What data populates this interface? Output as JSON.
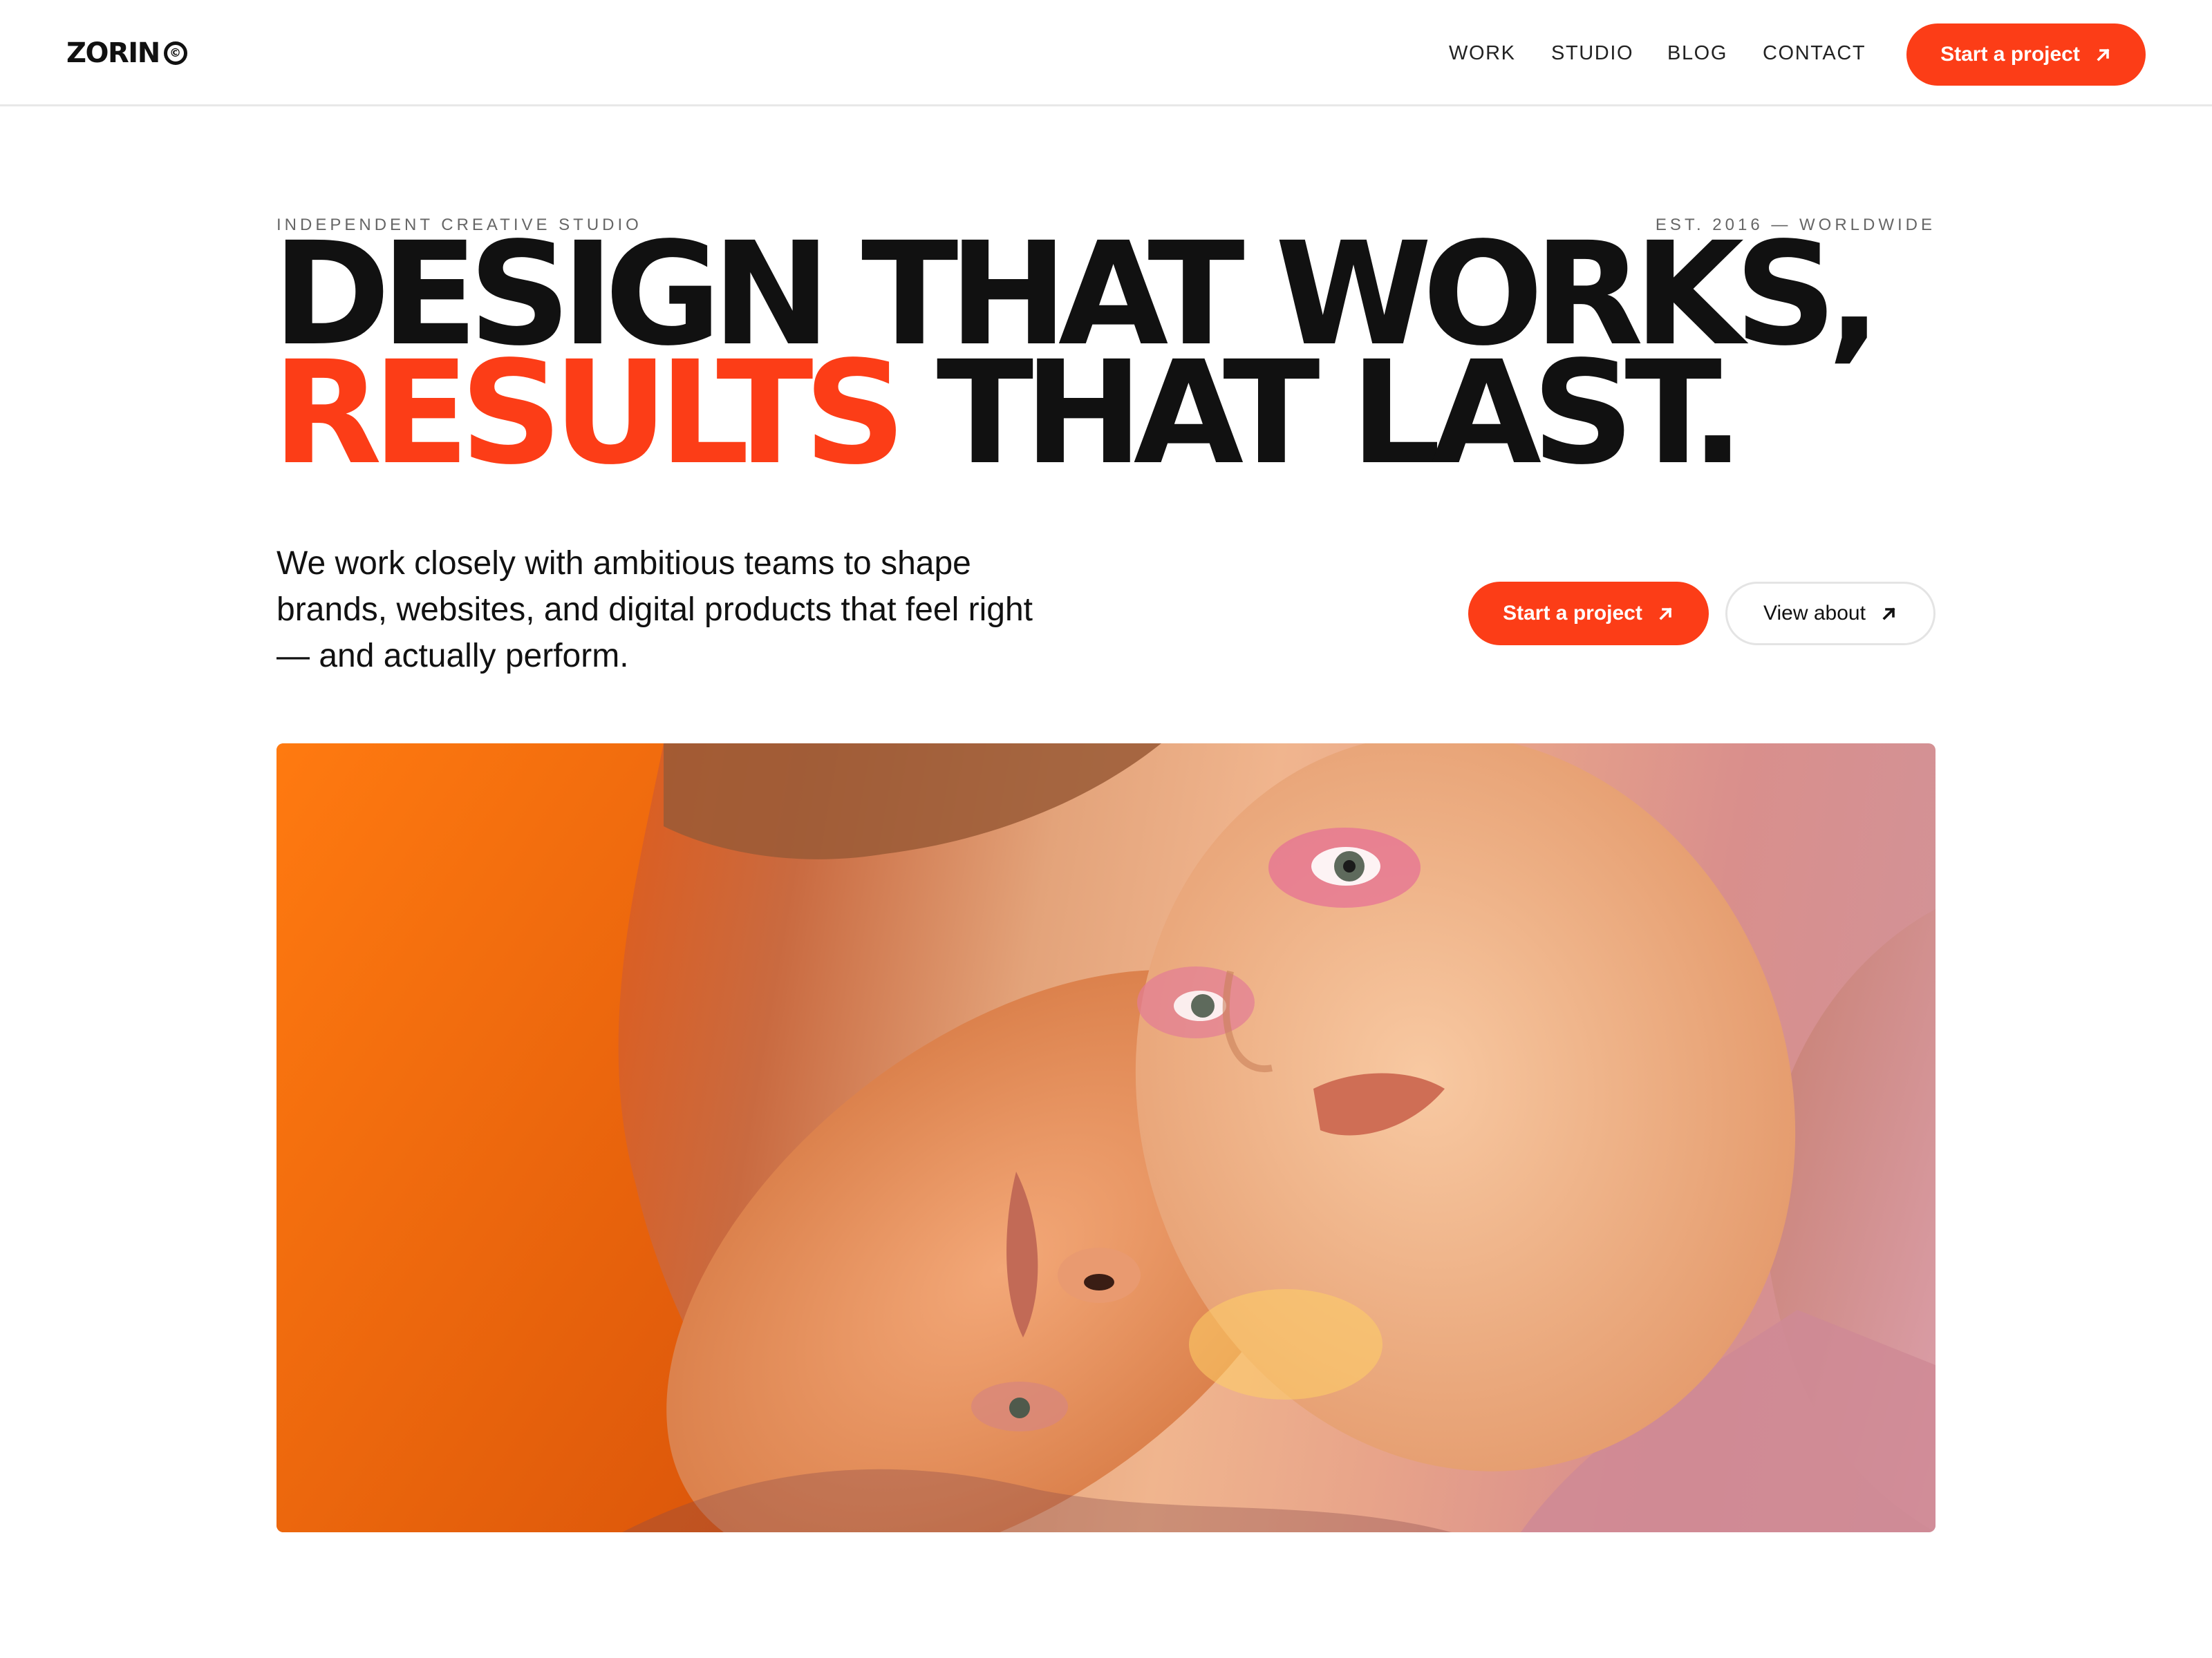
{
  "header": {
    "logo_text": "ZORIN",
    "logo_mark": "©",
    "nav": [
      {
        "label": "WORK"
      },
      {
        "label": "STUDIO"
      },
      {
        "label": "BLOG"
      },
      {
        "label": "CONTACT"
      }
    ],
    "cta_label": "Start a project",
    "cta_icon": "arrow-up-right-icon"
  },
  "hero": {
    "eyebrow_left": "INDEPENDENT CREATIVE STUDIO",
    "eyebrow_right": "EST. 2016 — WORLDWIDE",
    "headline_line1": "DESIGN THAT WORKS,",
    "headline_accent": "RESULTS",
    "headline_line2_rest": " THAT LAST.",
    "lede": "We work closely with ambitious teams to shape brands, websites, and digital products that feel right — and actually perform.",
    "primary_cta_label": "Start a project",
    "secondary_cta_label": "View about"
  },
  "colors": {
    "accent": "#fc3d17",
    "text": "#111111",
    "muted": "#666666",
    "divider": "#e8e8e8"
  }
}
